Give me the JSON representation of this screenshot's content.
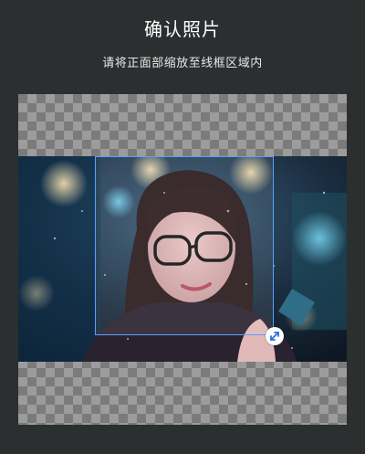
{
  "header": {
    "title": "确认照片",
    "subtitle": "请将正面部缩放至线框区域内"
  },
  "crop": {
    "handle_icon": "resize-diagonal-icon",
    "frame_color": "#5aa0ff"
  }
}
